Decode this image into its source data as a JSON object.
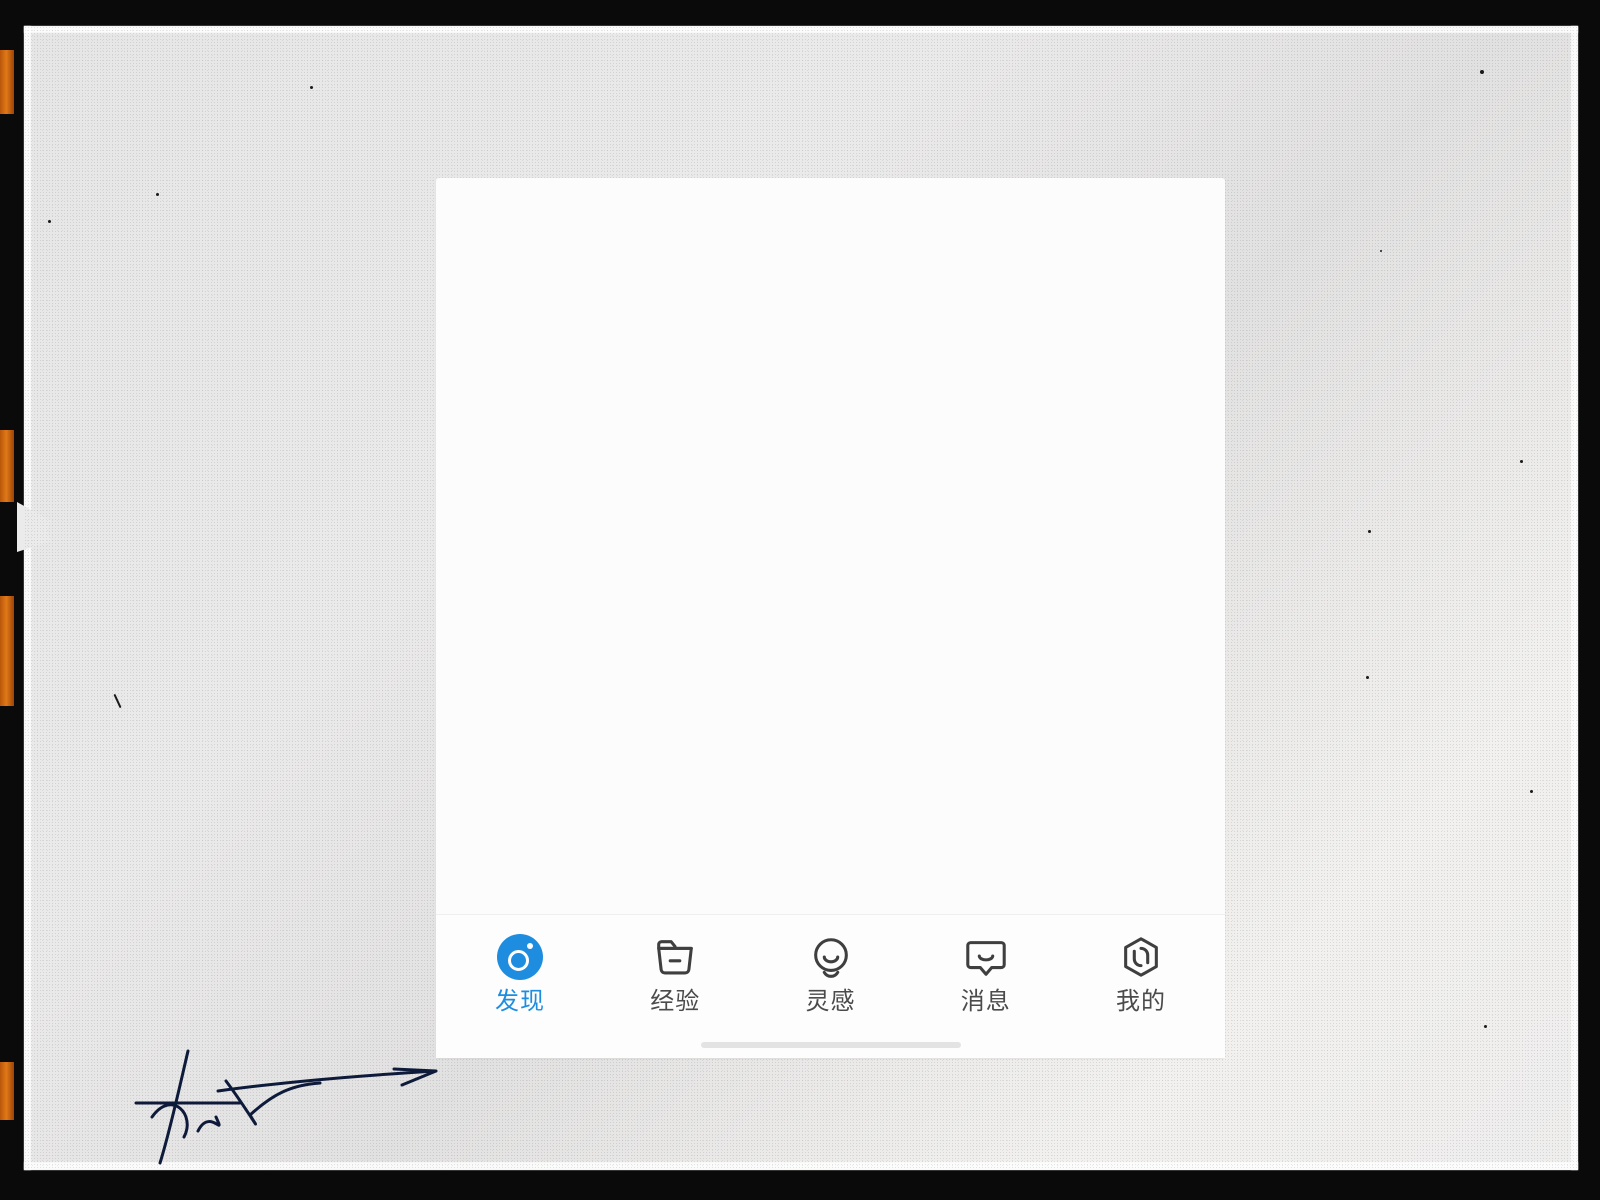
{
  "colors": {
    "accent": "#1e8de0",
    "icon_stroke": "#403f3f"
  },
  "tabbar": {
    "active_index": 0,
    "items": [
      {
        "icon": "discover-icon",
        "label": "发现"
      },
      {
        "icon": "folder-icon",
        "label": "经验"
      },
      {
        "icon": "face-icon",
        "label": "灵感"
      },
      {
        "icon": "message-icon",
        "label": "消息"
      },
      {
        "icon": "hex-icon",
        "label": "我的"
      }
    ]
  }
}
